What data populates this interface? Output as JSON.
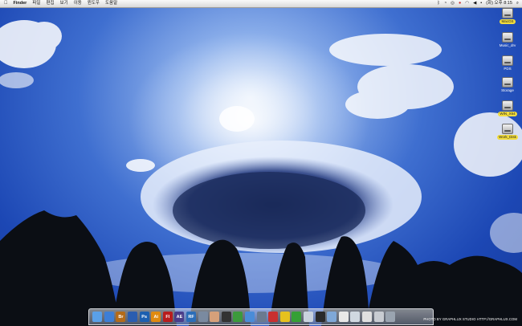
{
  "menubar": {
    "apple_icon": "apple-icon",
    "app_name": "Finder",
    "menus": [
      "파일",
      "편집",
      "보기",
      "이동",
      "윈도우",
      "도움말"
    ],
    "status": {
      "clock": "(화) 오후 8:15",
      "search_icon": "magnifier-icon"
    }
  },
  "desktop_icons": [
    {
      "label": "MacOS",
      "selected": true
    },
    {
      "label": "Music_drv",
      "selected": false
    },
    {
      "label": "PDS",
      "selected": false
    },
    {
      "label": "Storage",
      "selected": false
    },
    {
      "label": "WIN_X64",
      "selected": true
    },
    {
      "label": "Work_Disk",
      "selected": true
    }
  ],
  "dock": {
    "items": [
      {
        "name": "finder",
        "text": "",
        "color": "#5aa0e8"
      },
      {
        "name": "safari",
        "text": "",
        "color": "#3d7ed6"
      },
      {
        "name": "bridge",
        "text": "Br",
        "color": "#b36b1a"
      },
      {
        "name": "firefox",
        "text": "",
        "color": "#2a5db0"
      },
      {
        "name": "photoshop",
        "text": "Ps",
        "color": "#1c5fb0"
      },
      {
        "name": "illustrator",
        "text": "Ai",
        "color": "#e08a10"
      },
      {
        "name": "flash",
        "text": "Fl",
        "color": "#b81d1d"
      },
      {
        "name": "after-effects",
        "text": "AE",
        "color": "#4a3d8a"
      },
      {
        "name": "rename",
        "text": "RF",
        "color": "#2b6db8"
      },
      {
        "name": "preview",
        "text": "",
        "color": "#7a8aa0"
      },
      {
        "name": "hand",
        "text": "",
        "color": "#d6a07a"
      },
      {
        "name": "dvd",
        "text": "",
        "color": "#333333"
      },
      {
        "name": "messenger",
        "text": "",
        "color": "#3c9a3c"
      },
      {
        "name": "itunes",
        "text": "",
        "color": "#4a8cd8"
      },
      {
        "name": "iphoto",
        "text": "",
        "color": "#6a7a90"
      },
      {
        "name": "app-red",
        "text": "",
        "color": "#c83030"
      },
      {
        "name": "app-yellow",
        "text": "",
        "color": "#e6c21e"
      },
      {
        "name": "utorrent",
        "text": "",
        "color": "#35a035"
      },
      {
        "name": "folder-1",
        "text": "",
        "color": "#c9d2de"
      },
      {
        "name": "terminal",
        "text": "",
        "color": "#2a2a2a"
      },
      {
        "name": "folder-2",
        "text": "",
        "color": "#7fa8d8"
      },
      {
        "name": "document-1",
        "text": "",
        "color": "#e8e8e8"
      },
      {
        "name": "document-2",
        "text": "",
        "color": "#d0d8e0"
      },
      {
        "name": "document-3",
        "text": "",
        "color": "#e0e0e0"
      },
      {
        "name": "document-4",
        "text": "",
        "color": "#c8ccd2"
      },
      {
        "name": "trash",
        "text": "",
        "color": "#9aa4b0"
      }
    ]
  },
  "credit": "PHOTO BY GRAPHLUX STUDIO  HTTP://GRAPHLUX.COM"
}
